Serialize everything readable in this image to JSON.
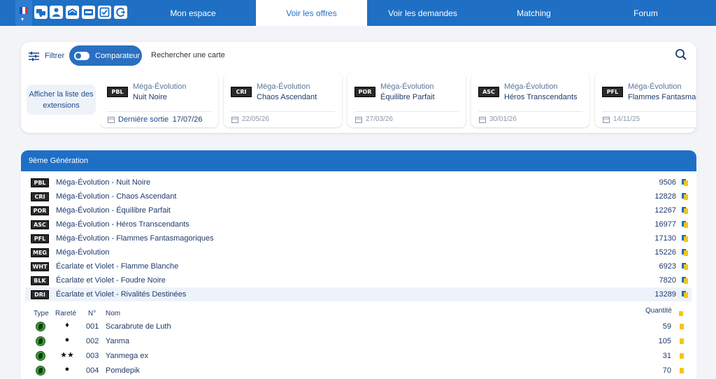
{
  "topbar": {
    "flag_colors": [
      "#1f4cb0",
      "#ffffff",
      "#e0303a"
    ],
    "icons": [
      "cards-stack-icon",
      "user-icon",
      "binder-icon",
      "promo-icon",
      "checklist-icon",
      "swap-icon"
    ],
    "tabs": [
      {
        "label": "Mon espace",
        "active": false
      },
      {
        "label": "Voir les offres",
        "active": true
      },
      {
        "label": "Voir les demandes",
        "active": false
      },
      {
        "label": "Matching",
        "active": false
      },
      {
        "label": "Forum",
        "active": false
      }
    ]
  },
  "search": {
    "filter_label": "Filtrer",
    "comparator_label": "Comparateur",
    "placeholder": "Rechercher une carte",
    "extensions_button": "Afficher la liste des extensions"
  },
  "releases": [
    {
      "code": "PBL",
      "series": "Méga-Évolution",
      "name": "Nuit Noire",
      "date_label": "Dernière sortie",
      "date": "17/07/26"
    },
    {
      "code": "CRI",
      "series": "Méga-Évolution",
      "name": "Chaos Ascendant",
      "date_label": "",
      "date": "22/05/26"
    },
    {
      "code": "POR",
      "series": "Méga-Évolution",
      "name": "Équilibre Parfait",
      "date_label": "",
      "date": "27/03/26"
    },
    {
      "code": "ASC",
      "series": "Méga-Évolution",
      "name": "Héros Transcendants",
      "date_label": "",
      "date": "30/01/26"
    },
    {
      "code": "PFL",
      "series": "Méga-Évolution",
      "name": "Flammes Fantasmagoriques",
      "date_label": "",
      "date": "14/11/25"
    }
  ],
  "generation": {
    "title": "9ème Génération",
    "sets": [
      {
        "code": "PBL",
        "name": "Méga-Évolution - Nuit Noire",
        "count": "9506"
      },
      {
        "code": "CRI",
        "name": "Méga-Évolution - Chaos Ascendant",
        "count": "12828"
      },
      {
        "code": "POR",
        "name": "Méga-Évolution - Équilibre Parfait",
        "count": "12267"
      },
      {
        "code": "ASC",
        "name": "Méga-Évolution - Héros Transcendants",
        "count": "16977"
      },
      {
        "code": "PFL",
        "name": "Méga-Évolution - Flammes Fantasmagoriques",
        "count": "17130"
      },
      {
        "code": "MEG",
        "name": "Méga-Évolution",
        "count": "15226"
      },
      {
        "code": "WHT",
        "name": "Écarlate et Violet - Flamme Blanche",
        "count": "6923"
      },
      {
        "code": "BLK",
        "name": "Écarlate et Violet - Foudre Noire",
        "count": "7820"
      },
      {
        "code": "DRI",
        "name": "Écarlate et Violet - Rivalités Destinées",
        "count": "13289"
      }
    ],
    "card_headers": {
      "type": "Type",
      "rarity": "Rareté",
      "number": "N°",
      "name": "Nom",
      "quantity": "Quantité"
    },
    "cards": [
      {
        "type": "grass",
        "rarity": "♦",
        "number": "001",
        "name": "Scarabrute de Luth",
        "quantity": "59"
      },
      {
        "type": "grass",
        "rarity": "●",
        "number": "002",
        "name": "Yanma",
        "quantity": "105"
      },
      {
        "type": "grass",
        "rarity": "★★",
        "number": "003",
        "name": "Yanmega ex",
        "quantity": "31"
      },
      {
        "type": "grass",
        "rarity": "●",
        "number": "004",
        "name": "Pomdepik",
        "quantity": "70"
      }
    ]
  }
}
